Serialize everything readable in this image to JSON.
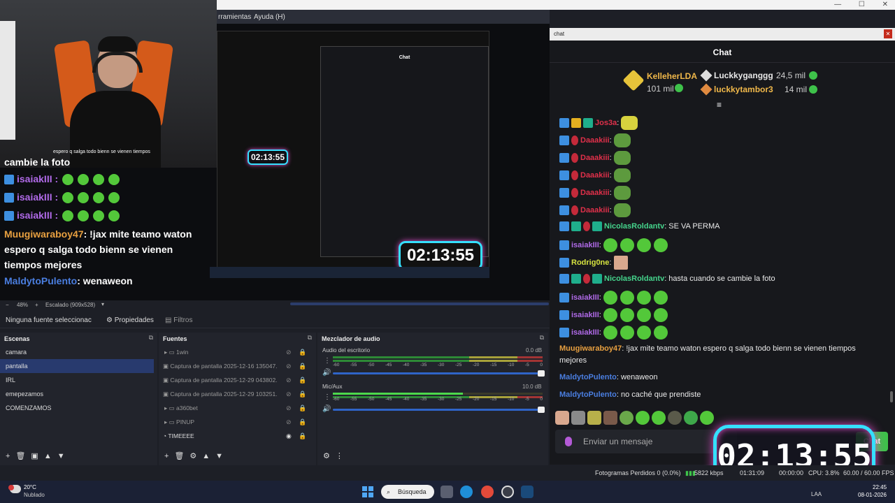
{
  "menu": {
    "tools": "rramientas",
    "help": "Ayuda (H)"
  },
  "preview": {
    "overlay_chat": {
      "line1": "cambie la foto",
      "user_isaia": "isaiakIII",
      "line_muugi_user": "Muugiwaraboy47",
      "line_muugi_text": ": !jax mite teamo waton espero q salga todo bienn se vienen tiempos mejores",
      "line_maldy_user": "MaldytoPulento",
      "line_maldy_text": ": wenaweon",
      "top_snippet": "espero q salga todo bienn se vienen tiempos"
    },
    "timer_small": "02:13:55",
    "timer_mid": "02:13:55",
    "inner_chat_title": "Chat"
  },
  "zoombar": {
    "zoom": "48%",
    "scale": "Escalado (909x528)"
  },
  "sourcebar": {
    "no_source": "Ninguna fuente seleccionac",
    "properties": "Propiedades",
    "filters": "Filtros"
  },
  "scenes": {
    "title": "Escenas",
    "items": [
      "camara",
      "pantalla",
      "IRL",
      "emepezamos",
      "COMENZAMOS"
    ],
    "active_index": 1
  },
  "sources": {
    "title": "Fuentes",
    "items": [
      "1win",
      "Captura de pantalla 2025-12-16 135047.",
      "Captura de pantalla 2025-12-29 043802.",
      "Captura de pantalla 2025-12-29 103251.",
      "a360bet",
      "PINUP",
      "TIMEEEE"
    ]
  },
  "audio": {
    "title": "Mezclador de audio",
    "tracks": [
      {
        "name": "Audio del escritorio",
        "db": "0.0 dB",
        "level": 0.0
      },
      {
        "name": "Mic/Aux",
        "db": "10.0 dB",
        "level": 0.62
      }
    ],
    "ticks": [
      "-60",
      "-55",
      "-50",
      "-45",
      "-40",
      "-35",
      "-30",
      "-25",
      "-20",
      "-15",
      "-10",
      "-5",
      "0"
    ]
  },
  "chat": {
    "window_title": "chat",
    "header": "Chat",
    "leaderboard": [
      {
        "name": "KelleherLDA",
        "value": "101 mil",
        "color": "#f0b84a"
      },
      {
        "name": "Luckkyganggg",
        "value": "24,5 mil",
        "color": "#e8e8e8"
      },
      {
        "name": "luckkytambor3",
        "value": "14 mil",
        "color": "#f0b84a"
      }
    ],
    "messages": [
      {
        "user": "Jos3a",
        "text": ":",
        "color": "#e0304a"
      },
      {
        "user": "Daaakiii",
        "text": ":",
        "color": "#e0304a"
      },
      {
        "user": "Daaakiii",
        "text": ":",
        "color": "#e0304a"
      },
      {
        "user": "Daaakiii",
        "text": ":",
        "color": "#e0304a"
      },
      {
        "user": "Daaakiii",
        "text": ":",
        "color": "#e0304a"
      },
      {
        "user": "Daaakiii",
        "text": ":",
        "color": "#e0304a"
      },
      {
        "user": "NicolasRoldantv",
        "text": ": SE VA PERMA",
        "color": "#45d48c"
      },
      {
        "user": "isaiakIII",
        "text": ":",
        "color": "#b06ae8"
      },
      {
        "user": "Rodrig0ne",
        "text": ":",
        "color": "#d6e340"
      },
      {
        "user": "NicolasRoldantv",
        "text": ": hasta cuando se cambie la foto",
        "color": "#45d48c"
      },
      {
        "user": "isaiakIII",
        "text": ":",
        "color": "#b06ae8"
      },
      {
        "user": "isaiakIII",
        "text": ":",
        "color": "#b06ae8"
      },
      {
        "user": "isaiakIII",
        "text": ":",
        "color": "#b06ae8"
      },
      {
        "user": "Muugiwaraboy47",
        "text": ": !jax mite teamo waton espero q salga todo bienn se vienen tiempos mejores",
        "color": "#e8a040"
      },
      {
        "user": "MaldytoPulento",
        "text": ": wenaweon",
        "color": "#4a7ee0"
      },
      {
        "user": "MaldytoPulento",
        "text": ": no caché que prendiste",
        "color": "#4a7ee0"
      }
    ],
    "input_placeholder": "Enviar un mensaje",
    "send_label": "Chat",
    "timer": "02:13:55"
  },
  "status": {
    "dropped": "Fotogramas Perdidos 0 (0.0%)",
    "bitrate": "5822 kbps",
    "rec_time": "01:31:09",
    "time2": "00:00:00",
    "cpu": "CPU: 3.8%",
    "fps": "60.00 / 60.00 FPS"
  },
  "taskbar": {
    "temp": "20°C",
    "weather": "Nublado",
    "search": "Búsqueda",
    "lang": "LAA",
    "time": "22:45",
    "date": "08-01-2026"
  },
  "colors": {
    "accent": "#35e0ff",
    "glow": "#e04dc8",
    "active_scene": "#283a6e",
    "send": "#3ec24a"
  }
}
